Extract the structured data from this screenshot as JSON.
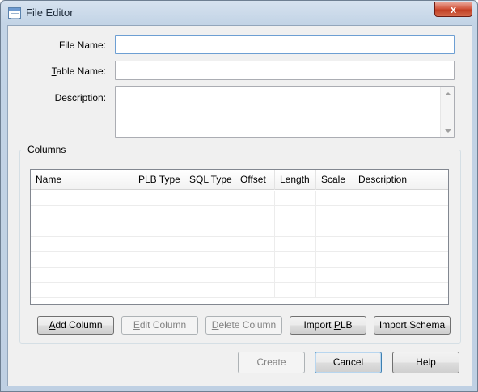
{
  "window": {
    "title": "File Editor",
    "close_glyph": "x"
  },
  "form": {
    "file_name": {
      "label": "File Name:",
      "value": ""
    },
    "table_name": {
      "label_prefix": "T",
      "label_rest": "able Name:",
      "value": ""
    },
    "description": {
      "label": "Description:",
      "value": ""
    }
  },
  "columns": {
    "group_label": "Columns",
    "headers": [
      "Name",
      "PLB Type",
      "SQL Type",
      "Offset",
      "Length",
      "Scale",
      "Description"
    ],
    "rows": []
  },
  "column_buttons": {
    "add": {
      "prefix": "A",
      "rest": "dd Column"
    },
    "edit": {
      "prefix": "E",
      "rest": "dit Column"
    },
    "delete": {
      "prefix": "D",
      "rest": "elete Column"
    },
    "import_plb": {
      "text": "Import ",
      "underlined": "P",
      "rest": "LB"
    },
    "import_schema": {
      "label": "Import Schema"
    }
  },
  "dialog_buttons": {
    "create": "Create",
    "cancel": "Cancel",
    "help": "Help"
  }
}
